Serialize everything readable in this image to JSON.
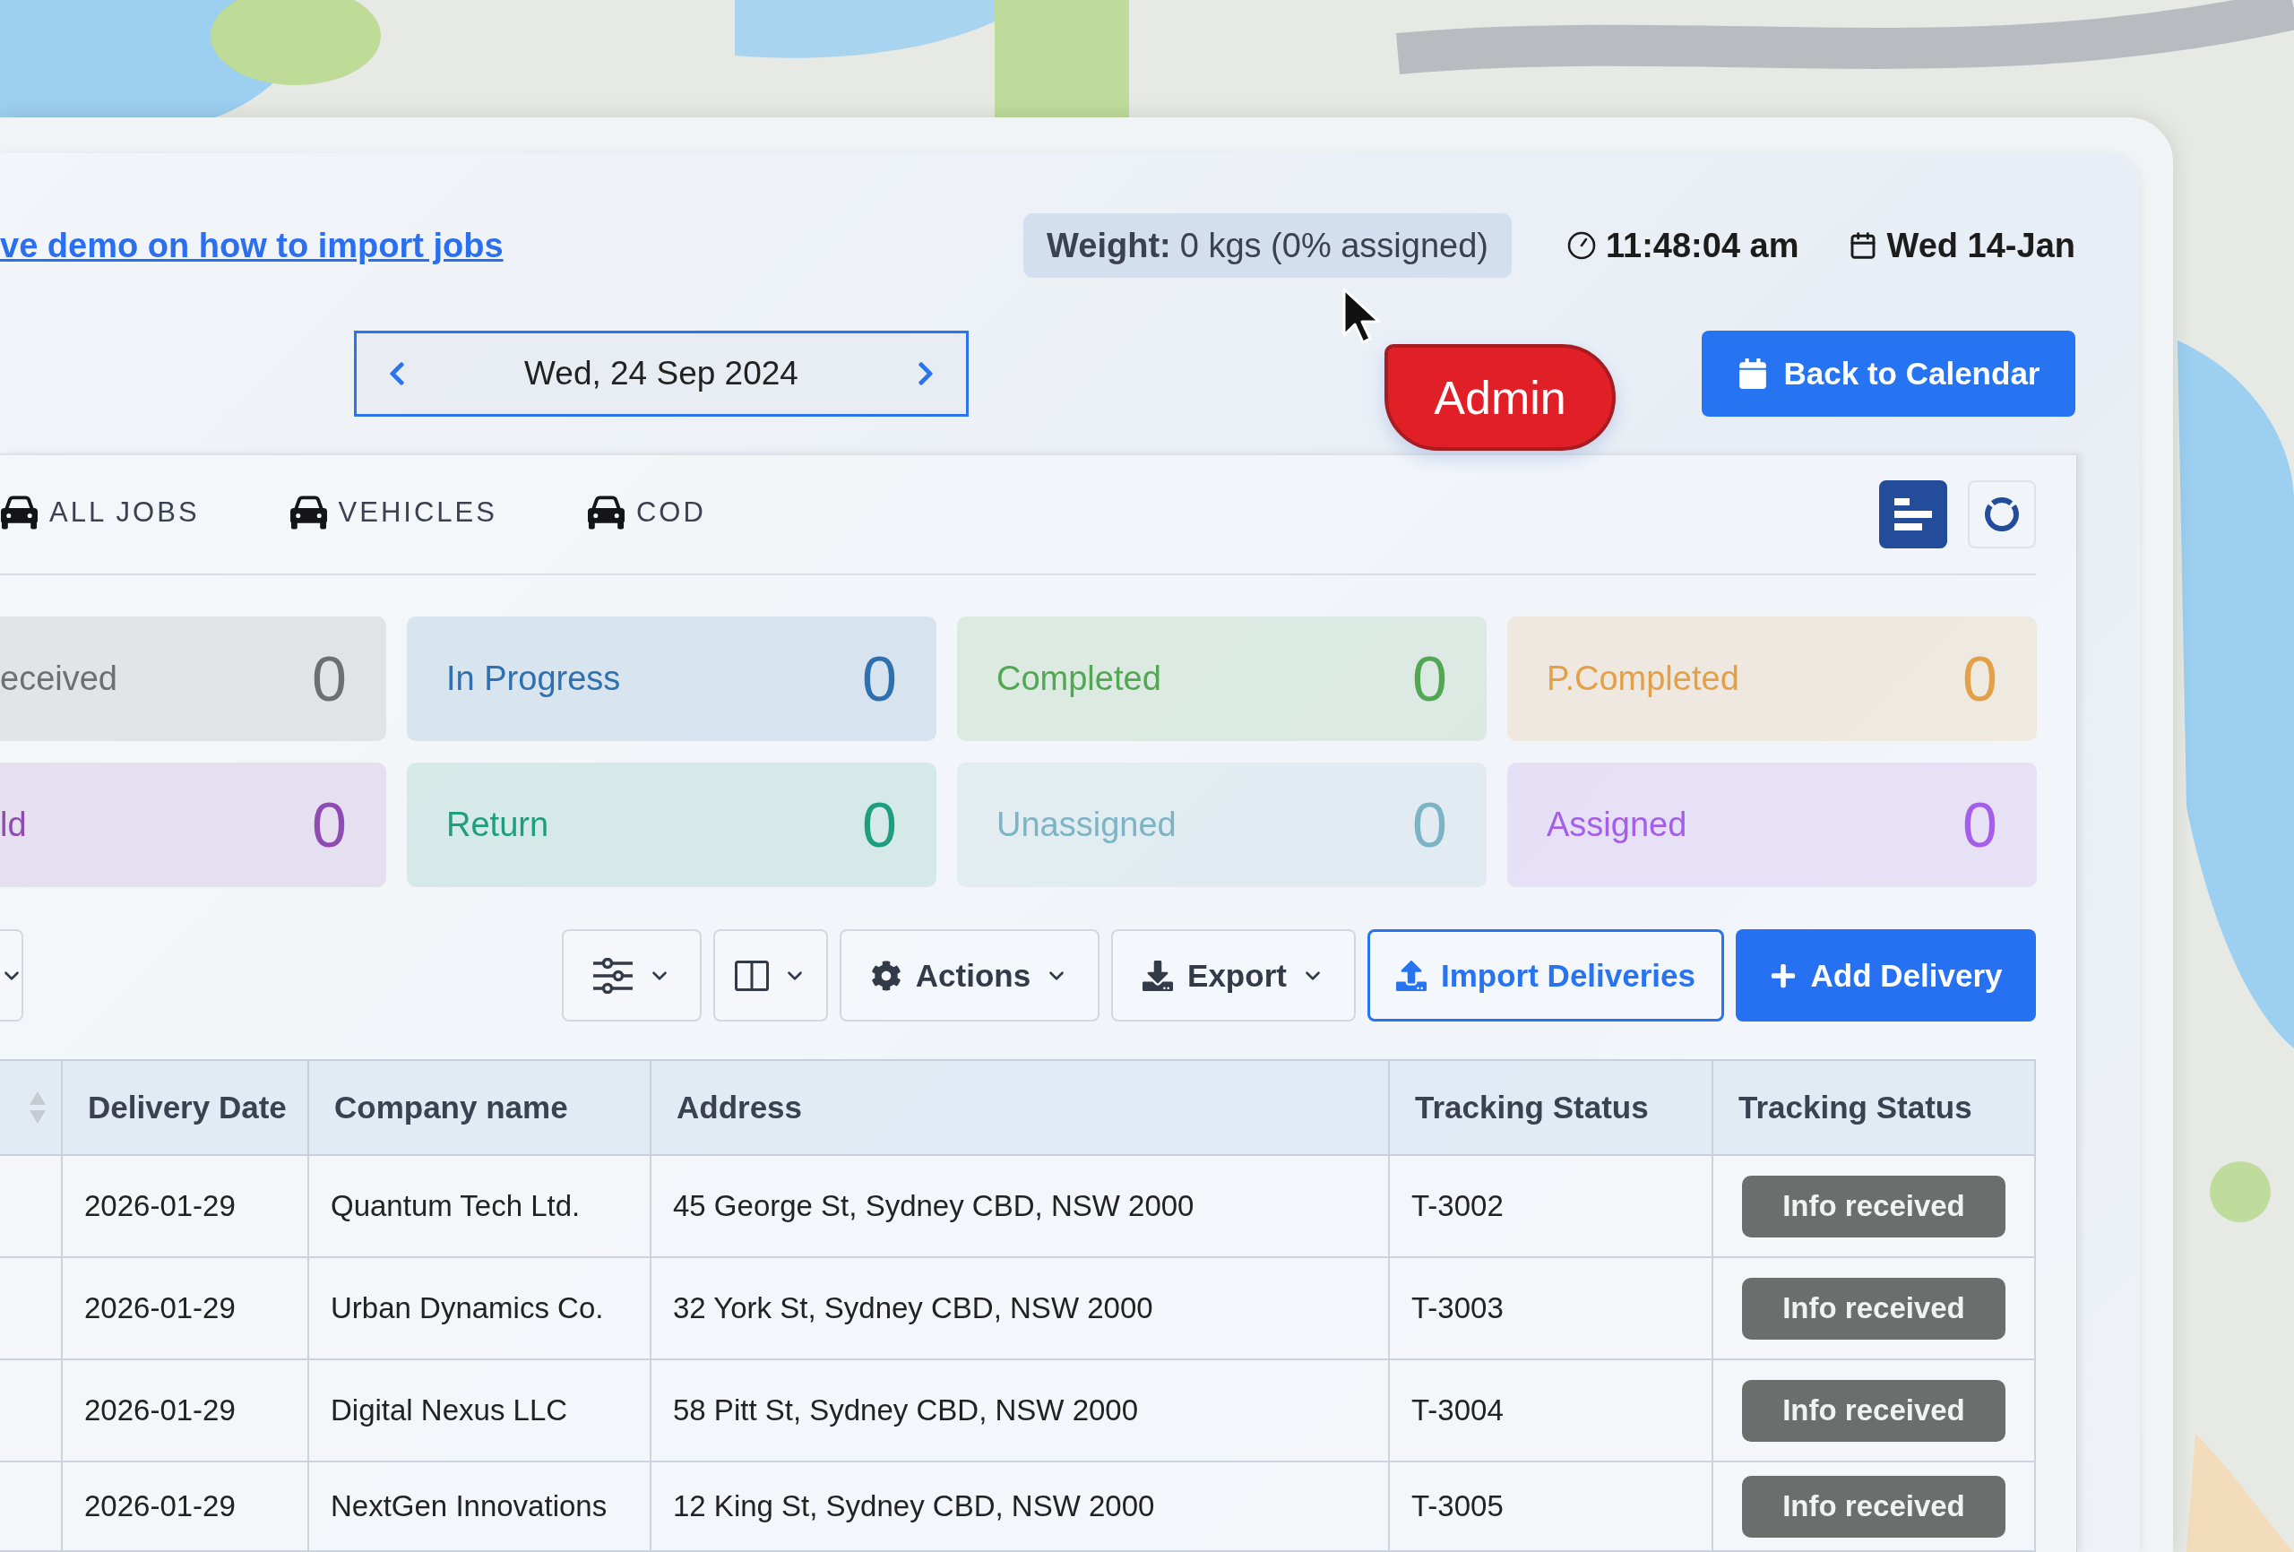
{
  "help_link": {
    "text": "ve demo on how to import jobs"
  },
  "weight": {
    "label": "Weight:",
    "value": "0 kgs (0% assigned)"
  },
  "clock": {
    "time": "11:48:04 am",
    "date": "Wed 14-Jan"
  },
  "date_picker": {
    "value": "Wed, 24 Sep 2024"
  },
  "back_button": {
    "label": "Back to Calendar"
  },
  "pointer_tooltip": {
    "label": "Admin"
  },
  "tabs": [
    {
      "label": "ALL JOBS",
      "selected": false
    },
    {
      "label": "VEHICLES",
      "selected": false
    },
    {
      "label": "COD",
      "selected": false
    }
  ],
  "view_toggle": [
    {
      "kind": "bars",
      "selected": true
    },
    {
      "kind": "donut",
      "selected": false
    }
  ],
  "stats": [
    {
      "label": "eceived",
      "value": "0",
      "color": "#6d7071"
    },
    {
      "label": "In Progress",
      "value": "0",
      "color": "#2f70b0"
    },
    {
      "label": "Completed",
      "value": "0",
      "color": "#52a852"
    },
    {
      "label": "P.Completed",
      "value": "0",
      "color": "#e3a047"
    },
    {
      "label": "ld",
      "value": "0",
      "color": "#8e4cb3"
    },
    {
      "label": "Return",
      "value": "0",
      "color": "#1f9e7f"
    },
    {
      "label": "Unassigned",
      "value": "0",
      "color": "#7db4c5"
    },
    {
      "label": "Assigned",
      "value": "0",
      "color": "#a55ee9"
    }
  ],
  "toolbar": [
    {
      "kind": "dropdown"
    },
    {
      "kind": "filter"
    },
    {
      "kind": "columns"
    },
    {
      "kind": "actions",
      "label": "Actions"
    },
    {
      "kind": "export",
      "label": "Export"
    },
    {
      "kind": "import",
      "label": "Import Deliveries"
    },
    {
      "kind": "add",
      "label": "Add Delivery"
    }
  ],
  "table": {
    "columns": [
      "Delivery Date",
      "Company name",
      "Address",
      "Tracking Status",
      "Tracking Status"
    ],
    "rows": [
      {
        "delivery_date": "2026-01-29",
        "company_name": "Quantum Tech Ltd.",
        "address": "45 George St, Sydney CBD, NSW 2000",
        "tracking_status": "T-3002",
        "status": "Info received"
      },
      {
        "delivery_date": "2026-01-29",
        "company_name": "Urban Dynamics Co.",
        "address": "32 York St, Sydney CBD, NSW 2000",
        "tracking_status": "T-3003",
        "status": "Info received"
      },
      {
        "delivery_date": "2026-01-29",
        "company_name": "Digital Nexus LLC",
        "address": "58 Pitt St, Sydney CBD, NSW 2000",
        "tracking_status": "T-3004",
        "status": "Info received"
      },
      {
        "delivery_date": "2026-01-29",
        "company_name": "NextGen Innovations",
        "address": "12 King St, Sydney CBD, NSW 2000",
        "tracking_status": "T-3005",
        "status": "Info received"
      }
    ]
  }
}
